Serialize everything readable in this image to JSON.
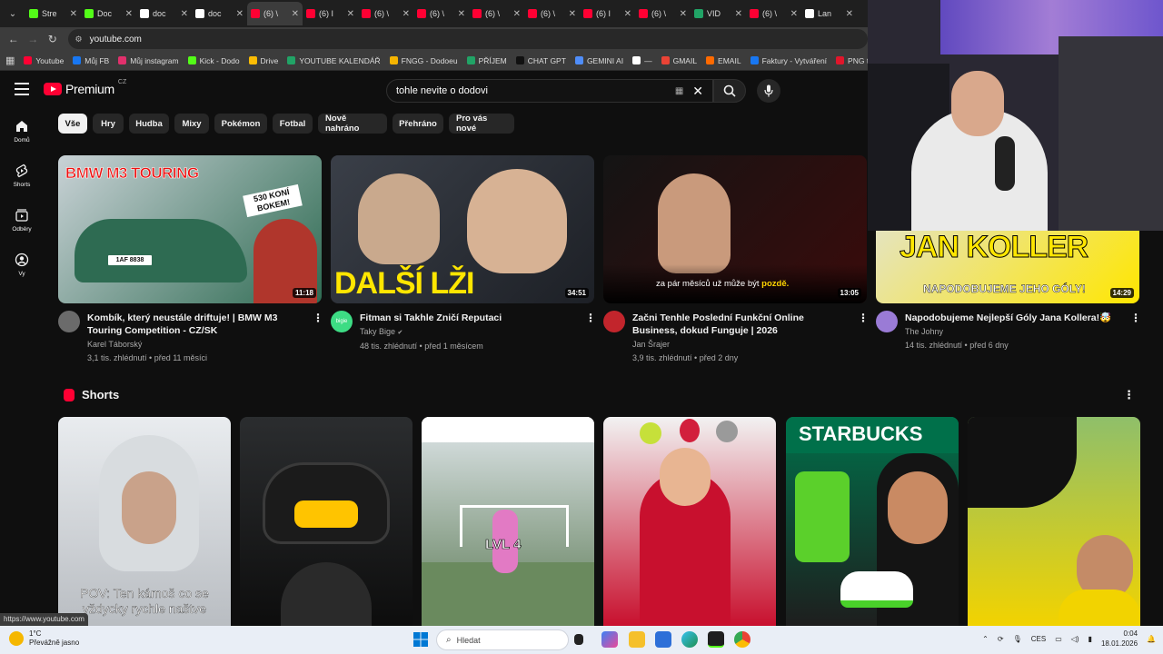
{
  "browser": {
    "tabs": [
      {
        "label": "Stre",
        "color": "#53fc18"
      },
      {
        "label": "Doc",
        "color": "#53fc18"
      },
      {
        "label": "doc",
        "color": "#ffffff"
      },
      {
        "label": "doc",
        "color": "#ffffff"
      },
      {
        "label": "(6) \\",
        "color": "#ff0033",
        "active": true
      },
      {
        "label": "(6) I",
        "color": "#ff0033"
      },
      {
        "label": "(6) \\",
        "color": "#ff0033"
      },
      {
        "label": "(6) \\",
        "color": "#ff0033"
      },
      {
        "label": "(6) \\",
        "color": "#ff0033"
      },
      {
        "label": "(6) \\",
        "color": "#ff0033"
      },
      {
        "label": "(6) I",
        "color": "#ff0033"
      },
      {
        "label": "(6) \\",
        "color": "#ff0033"
      },
      {
        "label": "VID",
        "color": "#21a366"
      },
      {
        "label": "(6) \\",
        "color": "#ff0033"
      },
      {
        "label": "Lan",
        "color": "#ffffff"
      }
    ],
    "url": "youtube.com",
    "bookmarks": [
      {
        "label": "Youtube",
        "color": "#ff0033"
      },
      {
        "label": "Můj FB",
        "color": "#1877f2"
      },
      {
        "label": "Můj instagram",
        "color": "#e1306c"
      },
      {
        "label": "Kick - Dodo",
        "color": "#53fc18"
      },
      {
        "label": "Drive",
        "color": "#fbbc04"
      },
      {
        "label": "YOUTUBE KALENDÁŘ",
        "color": "#21a366"
      },
      {
        "label": "FNGG - Dodoeu",
        "color": "#f5b400"
      },
      {
        "label": "PŘÍJEM",
        "color": "#21a366"
      },
      {
        "label": "CHAT GPT",
        "color": "#111111"
      },
      {
        "label": "GEMINI AI",
        "color": "#4f8df9"
      },
      {
        "label": "—",
        "color": "#ffffff"
      },
      {
        "label": "GMAIL",
        "color": "#ea4335"
      },
      {
        "label": "EMAIL",
        "color": "#ff6a00"
      },
      {
        "label": "Faktury - Vytváření",
        "color": "#1877f2"
      },
      {
        "label": "PNG to PDF",
        "color": "#e0162b"
      }
    ],
    "status_url": "https://www.youtube.com"
  },
  "header": {
    "logo": "Premium",
    "region": "CZ",
    "search_query": "tohle nevite o dodovi",
    "keyboard_glyph": "▦",
    "clear_glyph": "✕"
  },
  "sidebar": {
    "items": [
      {
        "label": "Domů",
        "icon": "home-icon"
      },
      {
        "label": "Shorts",
        "icon": "shorts-icon"
      },
      {
        "label": "Odběry",
        "icon": "subscriptions-icon"
      },
      {
        "label": "Vy",
        "icon": "you-icon"
      }
    ]
  },
  "chips": [
    "Vše",
    "Hry",
    "Hudba",
    "Mixy",
    "Pokémon",
    "Fotbal",
    "Nově nahráno",
    "Přehráno",
    "Pro vás nové"
  ],
  "videos": [
    {
      "title": "Kombík, který neustále driftuje! | BMW M3 Touring Competition - CZ/SK",
      "channel": "Karel Táborský",
      "stats": "3,1 tis. zhlédnutí • před 11 měsíci",
      "duration": "11:18",
      "thumb_text": "BMW M3 TOURING",
      "thumb_text2": "530 KONÍ BOKEM!",
      "thumb_plate": "1AF 8838",
      "thumb_colors": [
        "#c9d2d6",
        "#2e6b52"
      ],
      "avatar_color": "#6b6b6b"
    },
    {
      "title": "Fitman si Takhle Zničí Reputaci",
      "channel": "Taky Bige",
      "verified": "✔",
      "stats": "48 tis. zhlédnutí • před 1 měsícem",
      "duration": "34:51",
      "thumb_text": "DALŠÍ LŽI",
      "thumb_colors": [
        "#3a3f48",
        "#1d2026"
      ],
      "avatar_color": "#3ddc84",
      "avatar_text": "bigie"
    },
    {
      "title": "Začni Tenhle Poslední Funkční Online Business, dokud Funguje | 2026",
      "channel": "Jan Šrajer",
      "stats": "3,9 tis. zhlédnutí • před 2 dny",
      "duration": "13:05",
      "thumb_text": "za pár měsíců už může být",
      "thumb_text_bold": "pozdě.",
      "thumb_colors": [
        "#141414",
        "#3a0b0b"
      ],
      "avatar_color": "#c2252c"
    },
    {
      "title": "Napodobujeme Nejlepší Góly Jana Kollera!🤯",
      "channel": "The Johny",
      "stats": "14 tis. zhlédnutí • před 6 dny",
      "duration": "14:29",
      "thumb_text": "JAN KOLLER",
      "thumb_text2": "NAPODOBUJEME JEHO GÓLY!",
      "thumb_colors": [
        "#dfe3e8",
        "#ffe600"
      ],
      "avatar_color": "#9a7bd6"
    }
  ],
  "shorts": {
    "title": "Shorts",
    "items": [
      {
        "caption": "POV: Ten kámoš co se vždycky rychle naštve",
        "colors": [
          "#e9ecef",
          "#b9bdc2"
        ]
      },
      {
        "caption": "",
        "colors": [
          "#2b2d2f",
          "#0d0d0d"
        ]
      },
      {
        "caption": "LVL 4",
        "colors": [
          "#dfe6ea",
          "#5c7a55"
        ]
      },
      {
        "caption": "",
        "colors": [
          "#f2f2f2",
          "#c8102e"
        ]
      },
      {
        "caption": "STARBUCKS",
        "colors": [
          "#00704a",
          "#1e1e1e"
        ]
      },
      {
        "caption": "",
        "colors": [
          "#8fbf6a",
          "#f2d300"
        ]
      }
    ]
  },
  "taskbar": {
    "temperature": "1°C",
    "weather": "Převážně jasno",
    "search_placeholder": "Hledat",
    "language": "CES",
    "time": "0:04",
    "date": "18.01.2026"
  },
  "colors": {
    "accent_red": "#ff0033",
    "bg": "#0f0f0f",
    "chip_bg": "#272727"
  }
}
